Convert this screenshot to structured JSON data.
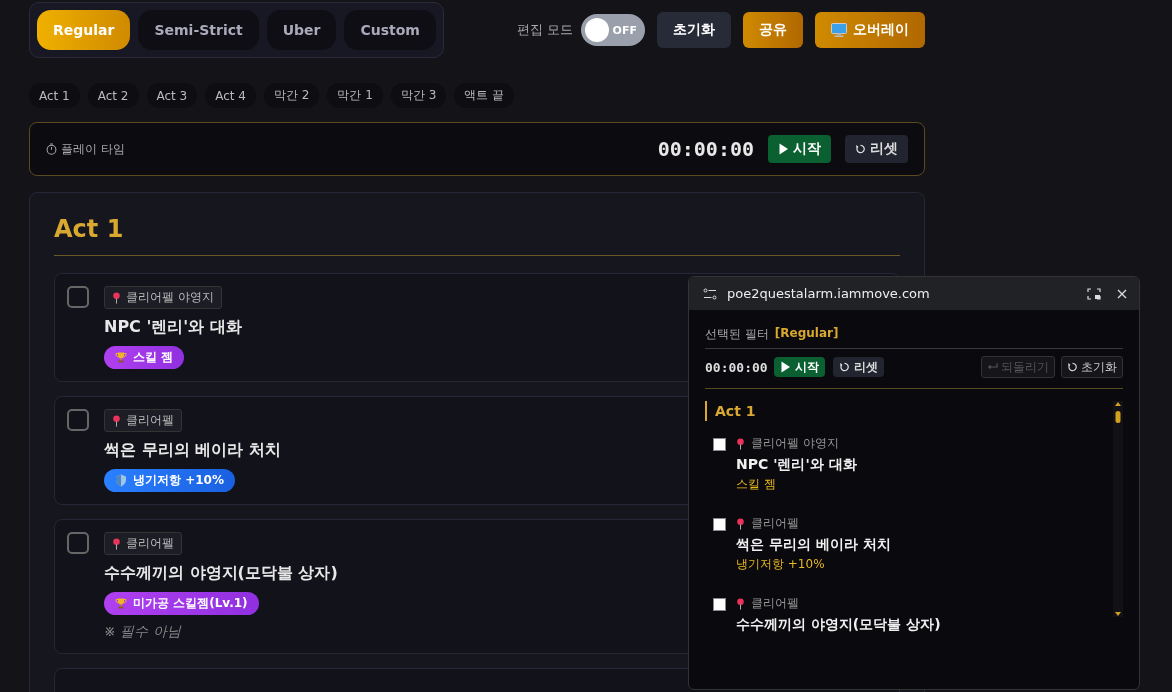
{
  "filters": [
    {
      "label": "Regular",
      "selected": true
    },
    {
      "label": "Semi-Strict",
      "selected": false
    },
    {
      "label": "Uber",
      "selected": false
    },
    {
      "label": "Custom",
      "selected": false
    }
  ],
  "edit_mode": {
    "label": "편집 모드",
    "on": false,
    "state_text": "OFF"
  },
  "header_buttons": [
    {
      "label": "초기화",
      "kind": "plain"
    },
    {
      "label": "공유",
      "kind": "accent"
    },
    {
      "label": "오버레이",
      "kind": "overlay"
    }
  ],
  "act_chips": [
    "Act 1",
    "Act 2",
    "Act 3",
    "Act 4",
    "막간 2",
    "막간 1",
    "막간 3",
    "액트 끝"
  ],
  "timer": {
    "label": "플레이 타임",
    "time": "00:00:00",
    "start": "시작",
    "reset": "리셋"
  },
  "act": {
    "title": "Act 1",
    "quests": [
      {
        "checked": false,
        "location": "클리어펠 야영지",
        "title": "NPC '렌리'와 대화",
        "reward": {
          "kind": "gem",
          "label": "스킬 젬"
        }
      },
      {
        "checked": false,
        "location": "클리어펠",
        "title": "썩은 무리의 베이라 처치",
        "reward": {
          "kind": "resist",
          "label": "냉기저항 +10%"
        }
      },
      {
        "checked": false,
        "location": "클리어펠",
        "title": "수수께끼의 야영지(모닥불 상자)",
        "reward": {
          "kind": "gem",
          "label": "미가공 스킬젬(Lv.1)"
        },
        "note": "※ 필수 아님"
      }
    ]
  },
  "overlay": {
    "title": "poe2questalarm.iammove.com",
    "filter_label": "선택된 필터",
    "filter_value": "[Regular]",
    "time": "00:00:00",
    "start": "시작",
    "reset": "리셋",
    "undo": {
      "label": "되돌리기",
      "disabled": true
    },
    "clear": "초기화",
    "act_title": "Act 1",
    "quests": [
      {
        "checked": false,
        "location": "클리어펠 야영지",
        "title": "NPC '렌리'와 대화",
        "reward": "스킬 젬"
      },
      {
        "checked": false,
        "location": "클리어펠",
        "title": "썩은 무리의 베이라 처치",
        "reward": "냉기저항 +10%"
      },
      {
        "checked": false,
        "location": "클리어펠",
        "title": "수수께끼의 야영지(모닥불 상자)"
      }
    ]
  }
}
